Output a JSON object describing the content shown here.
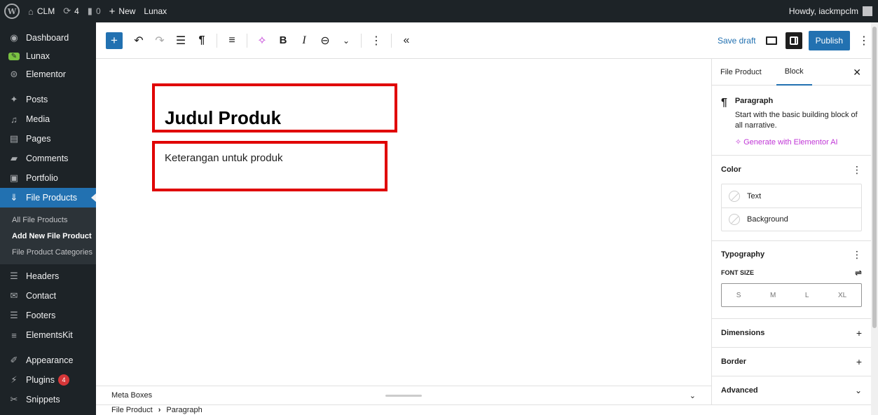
{
  "admin_bar": {
    "site_name": "CLM",
    "updates_count": "4",
    "comments_count": "0",
    "new_label": "New",
    "plugin_link": "Lunax",
    "greeting": "Howdy, iackmpclm"
  },
  "sidebar": {
    "items": [
      {
        "label": "Dashboard",
        "icon": "dashboard-icon"
      },
      {
        "label": "Lunax",
        "icon": "lunax-logo-icon"
      },
      {
        "label": "Elementor",
        "icon": "elementor-icon"
      },
      {
        "label": "Posts",
        "icon": "pin-icon"
      },
      {
        "label": "Media",
        "icon": "media-icon"
      },
      {
        "label": "Pages",
        "icon": "pages-icon"
      },
      {
        "label": "Comments",
        "icon": "comment-icon"
      },
      {
        "label": "Portfolio",
        "icon": "portfolio-icon"
      },
      {
        "label": "File Products",
        "icon": "download-icon"
      },
      {
        "label": "Headers",
        "icon": "header-icon"
      },
      {
        "label": "Contact",
        "icon": "mail-icon"
      },
      {
        "label": "Footers",
        "icon": "footer-icon"
      },
      {
        "label": "ElementsKit",
        "icon": "elementskit-icon"
      },
      {
        "label": "Appearance",
        "icon": "brush-icon"
      },
      {
        "label": "Plugins",
        "icon": "plugin-icon",
        "badge": "4"
      },
      {
        "label": "Snippets",
        "icon": "scissors-icon"
      }
    ],
    "submenu": [
      "All File Products",
      "Add New File Product",
      "File Product Categories"
    ]
  },
  "toolbar": {
    "save_draft": "Save draft",
    "publish": "Publish"
  },
  "canvas": {
    "title": "Judul Produk",
    "paragraph": "Keterangan untuk produk"
  },
  "meta": {
    "label": "Meta Boxes"
  },
  "breadcrumb": {
    "first": "File Product",
    "second": "Paragraph"
  },
  "panel": {
    "tabs": [
      "File Product",
      "Block"
    ],
    "block": {
      "title": "Paragraph",
      "description": "Start with the basic building block of all narrative.",
      "ai_link": "Generate with Elementor AI"
    },
    "color": {
      "heading": "Color",
      "items": [
        "Text",
        "Background"
      ]
    },
    "typography": {
      "heading": "Typography",
      "font_size_label": "FONT SIZE",
      "sizes": [
        "S",
        "M",
        "L",
        "XL"
      ]
    },
    "dimensions": "Dimensions",
    "border": "Border",
    "advanced": "Advanced"
  },
  "colors": {
    "accent": "#2271b1",
    "admin_dark": "#1d2327",
    "highlight_box": "#e00000",
    "ai_purple": "#c036d6",
    "badge": "#d63638"
  }
}
